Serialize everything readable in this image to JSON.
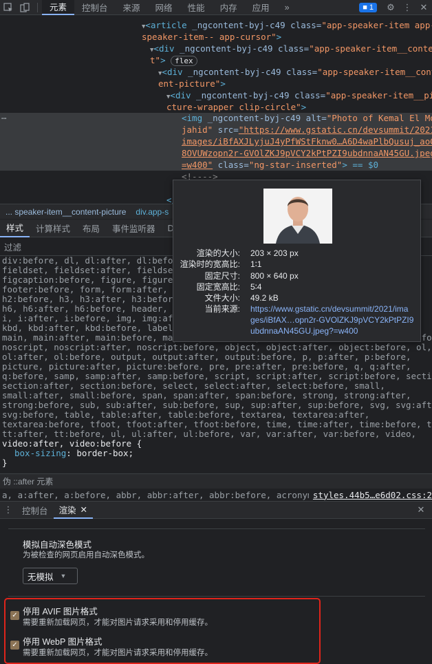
{
  "toolbar": {
    "tabs": [
      "元素",
      "控制台",
      "来源",
      "网络",
      "性能",
      "内存",
      "应用"
    ],
    "more": "»",
    "issues_count": "1"
  },
  "tree": {
    "line1_tag": "<article",
    "line1_attr": " _ngcontent-byj-c49 class=",
    "line1_val": "\"app-speaker-item app-",
    "line2_val": "speaker-item-- app-cursor\"",
    "line2_end": ">",
    "line3_tag": "<div",
    "line3_attr": " _ngcontent-byj-c49 class=",
    "line3_val": "\"app-speaker-item__conten",
    "line4_val": "t\"",
    "line4_end": ">",
    "flex_pill": "flex",
    "line5_tag": "<div",
    "line5_attr": " _ngcontent-byj-c49 class=",
    "line5_val": "\"app-speaker-item__cont",
    "line6_val": "ent-picture\"",
    "line6_end": ">",
    "line7_tag": "<div",
    "line7_attr": " _ngcontent-byj-c49 class=",
    "line7_val": "\"app-speaker-item__pi",
    "line8_val": "cture-wrapper clip-circle\"",
    "line8_end": ">",
    "img_tag": "<img",
    "img_attr1": " _ngcontent-byj-c49 alt=",
    "img_alt": "\"Photo of Kemal El Mou",
    "img_alt2": "jahid\"",
    "img_attr2": " src=",
    "img_src1": "\"https://www.gstatic.cn/devsummit/2021/",
    "img_src2": "images/iBfAXJLyjuJ4yPfWStFknw0…A6D4waPlbQusuj_aoGr",
    "img_src3": "8OVUWzopn2r-GVOlZKJ9pVCY2kPtPZI9ubdnnaAN45GU.jpeg?",
    "img_src4": "=w400\"",
    "img_attr3": " class=",
    "img_class": "\"ng-star-inserted\"",
    "img_end": "> == $0",
    "comment": "<!---->",
    "close_tag": "</"
  },
  "crumbs": [
    "... speaker-item__content-picture",
    "div.app-s"
  ],
  "subtabs": [
    "样式",
    "计算样式",
    "布局",
    "事件监听器",
    "D"
  ],
  "filter_label": "过滤",
  "styles": {
    "lines": [
      "div:before, dl, dl:after, dl:before",
      "fieldset, fieldset:after, fieldset",
      "figcaption:before, figure, figure:a",
      "footer:before, form, form:after, fo",
      "h2:before, h3, h3:after, h3:before,",
      "h6, h6:after, h6:before, header, he",
      "i, i:after, i:before, img, img:afte",
      "kbd, kbd:after, kbd:before, label, l",
      "main, main:after, main:before, map, map:after, map:before, nav, nav:after, nav:before,",
      "noscript, noscript:after, noscript:before, object, object:after, object:before, ol,",
      "ol:after, ol:before, output, output:after, output:before, p, p:after, p:before,",
      "picture, picture:after, picture:before, pre, pre:after, pre:before, q, q:after,",
      "q:before, samp, samp:after, samp:before, script, script:after, script:before, section,",
      "section:after, section:before, select, select:after, select:before, small,",
      "small:after, small:before, span, span:after, span:before, strong, strong:after,",
      "strong:before, sub, sub:after, sub:before, sup, sup:after, sup:before, svg, svg:after,",
      "svg:before, table, table:after, table:before, textarea, textarea:after,",
      "textarea:before, tfoot, tfoot:after, tfoot:before, time, time:after, time:before, tt,",
      "tt:after, tt:before, ul, ul:after, ul:before, var, var:after, var:before, video,"
    ],
    "last_sel": "video:after, video:before",
    "brace_open": " {",
    "prop": "box-sizing",
    "value": ": border-box;",
    "brace_close": "}"
  },
  "pseudo": {
    "label": "伪 ::after 元素",
    "row": "a, a:after, a:before, abbr, abbr:after, abbr:before, acronym,",
    "source": "styles.44b5…e6d02.css:2"
  },
  "drawer": {
    "tabs": [
      "控制台",
      "渲染"
    ],
    "dark_title": "模拟自动深色模式",
    "dark_desc": "为被检查的网页启用自动深色模式。",
    "select_value": "无模拟",
    "avif_title": "停用 AVIF 图片格式",
    "avif_desc": "需要重新加载网页，才能对图片请求采用和停用缓存。",
    "webp_title": "停用 WebP 图片格式",
    "webp_desc": "需要重新加载网页，才能对图片请求采用和停用缓存。"
  },
  "tooltip": {
    "rows": [
      {
        "k": "渲染的大小:",
        "v": "203 × 203 px"
      },
      {
        "k": "渲染时的宽高比:",
        "v": "1∶1"
      },
      {
        "k": "固定尺寸:",
        "v": "800 × 640 px"
      },
      {
        "k": "固定宽高比:",
        "v": "5∶4"
      },
      {
        "k": "文件大小:",
        "v": "49.2 kB"
      }
    ],
    "source_k": "当前来源:",
    "source_v1": "https://www.gstatic.cn/devsummit/2021/ima",
    "source_v2": "ges/iBfAX…opn2r-GVOlZKJ9pVCY2kPtPZI9",
    "source_v3": "ubdnnaAN45GU.jpeg?=w400"
  },
  "colors": {
    "accent": "#8ab4f8",
    "highlight_box": "#e0241b",
    "checkbox": "#8b7355"
  }
}
